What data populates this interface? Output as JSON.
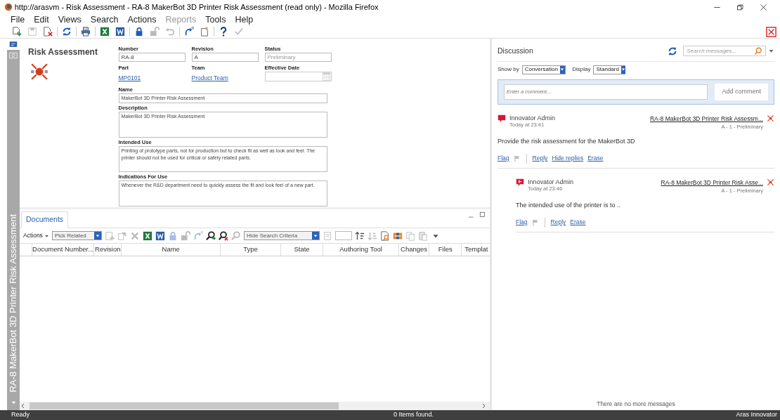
{
  "window": {
    "title": "http://arasvm - Risk Assessment - RA-8 MakerBot 3D Printer Risk Assessment (read only) - Mozilla Firefox"
  },
  "menu": [
    {
      "label": "File",
      "disabled": false
    },
    {
      "label": "Edit",
      "disabled": false
    },
    {
      "label": "Views",
      "disabled": false
    },
    {
      "label": "Search",
      "disabled": false
    },
    {
      "label": "Actions",
      "disabled": false
    },
    {
      "label": "Reports",
      "disabled": true
    },
    {
      "label": "Tools",
      "disabled": false
    },
    {
      "label": "Help",
      "disabled": false
    }
  ],
  "toolbar": [
    [
      {
        "kind": "new",
        "disabled": false
      },
      {
        "kind": "save",
        "disabled": true
      },
      {
        "kind": "delete",
        "disabled": false
      }
    ],
    [
      {
        "kind": "refresh",
        "disabled": false
      }
    ],
    [
      {
        "kind": "print",
        "disabled": false
      }
    ],
    [
      {
        "kind": "excel",
        "disabled": false
      },
      {
        "kind": "word",
        "disabled": false
      }
    ],
    [
      {
        "kind": "lock",
        "disabled": false
      },
      {
        "kind": "unlock",
        "disabled": true
      },
      {
        "kind": "undo",
        "disabled": true
      }
    ],
    [
      {
        "kind": "promote",
        "disabled": false
      },
      {
        "kind": "page",
        "disabled": false
      }
    ],
    [
      {
        "kind": "help",
        "disabled": false
      },
      {
        "kind": "check",
        "disabled": true
      }
    ]
  ],
  "side_tabs": [
    {
      "kind": "form",
      "selected": true
    },
    {
      "kind": "view",
      "selected": false
    }
  ],
  "side_caption": "RA-8 MakerBot 3D Printer Risk Assessment",
  "form": {
    "heading": "Risk Assessment",
    "fields": [
      {
        "kind": "input",
        "label": "Number",
        "value": "RA-8",
        "disabled": false
      },
      {
        "kind": "input",
        "label": "Revision",
        "value": "A",
        "disabled": false
      },
      {
        "kind": "input",
        "label": "Status",
        "value": "Preliminary",
        "disabled": true
      },
      {
        "kind": "link",
        "label": "Part",
        "value": "MP0101"
      },
      {
        "kind": "link",
        "label": "Team",
        "value": "Product Team"
      },
      {
        "kind": "date",
        "label": "Effective Date"
      }
    ],
    "wide_fields": [
      {
        "kind": "input",
        "label": "Name",
        "value": "MakerBot 3D Printer Risk Assessment"
      },
      {
        "kind": "textarea",
        "label": "Description",
        "value": "MakerBot 3D Printer Risk Assessment"
      },
      {
        "kind": "textarea",
        "label": "Intended Use",
        "value": "Printing of prototype parts, not for production but to check fit as well as look and feel. The printer should not be used for critical or safety related parts."
      },
      {
        "kind": "textarea",
        "label": "Indications For Use",
        "value": "Whenever the R&D department need to quickly assess the fit and look feel of a new part."
      }
    ]
  },
  "documents": {
    "tabs": [
      {
        "label": "Documents",
        "selected": true
      }
    ],
    "toolbar": [
      {
        "kind": "menu",
        "label": "Actions"
      },
      {
        "kind": "select",
        "value": "Pick Related"
      },
      {
        "kind": "add",
        "disabled": true
      },
      {
        "kind": "pick",
        "disabled": true
      },
      {
        "kind": "remove",
        "disabled": true
      },
      {
        "kind": "excel",
        "disabled": false
      },
      {
        "kind": "word",
        "disabled": false
      },
      {
        "kind": "lock",
        "disabled": true
      },
      {
        "kind": "unlock",
        "disabled": true
      },
      {
        "kind": "promote",
        "disabled": true
      },
      {
        "kind": "search",
        "disabled": false
      },
      {
        "kind": "clearsearch",
        "disabled": false
      },
      {
        "kind": "searchoff",
        "disabled": true
      },
      {
        "kind": "select",
        "value": "Hide Search Criteria"
      },
      {
        "kind": "blank",
        "disabled": true
      },
      {
        "kind": "field"
      },
      {
        "kind": "sortup",
        "disabled": false
      },
      {
        "kind": "sortdown",
        "disabled": true
      },
      {
        "kind": "find",
        "disabled": false
      },
      {
        "kind": "columns",
        "disabled": false
      },
      {
        "kind": "copy",
        "disabled": true
      },
      {
        "kind": "paste",
        "disabled": true
      },
      {
        "kind": "more",
        "disabled": false
      }
    ],
    "columns": [
      "Document Number...",
      "Revision",
      "Name",
      "Type",
      "State",
      "Authoring Tool",
      "Changes",
      "Files",
      "Templat"
    ]
  },
  "discussion": {
    "title": "Discussion",
    "search": {
      "placeholder": "Search messages..."
    },
    "show_by": {
      "label": "Show by",
      "value": "Conversation"
    },
    "display": {
      "label": "Display",
      "value": "Standard"
    },
    "comment": {
      "placeholder": "Enter a comment...",
      "button": "Add comment"
    },
    "messages": [
      {
        "kind": "comment",
        "author": "Innovator Admin",
        "time": "Today at 23:41",
        "item": "RA-8 MakerBot 3D Printer Risk Assessm...",
        "item_state": "A - 1 - Preliminary",
        "text": "Provide the risk assessment for the MakerBot 3D",
        "actions": [
          "Flag",
          "Reply",
          "Hide replies",
          "Erase"
        ],
        "children": [
          {
            "kind": "reply",
            "author": "Innovator Admin",
            "time": "Today at 23:46",
            "item": "RA-8 MakerBot 3D Printer Risk Asse...",
            "item_state": "A - 1 - Preliminary",
            "text": "The intended use of the printer is to ..",
            "actions": [
              "Flag",
              "Reply",
              "Erase"
            ]
          }
        ]
      }
    ],
    "footer": "There are no more messages"
  },
  "status_bar": {
    "left": "Ready",
    "center": "0 Items found.",
    "right": "Aras Innovator"
  }
}
